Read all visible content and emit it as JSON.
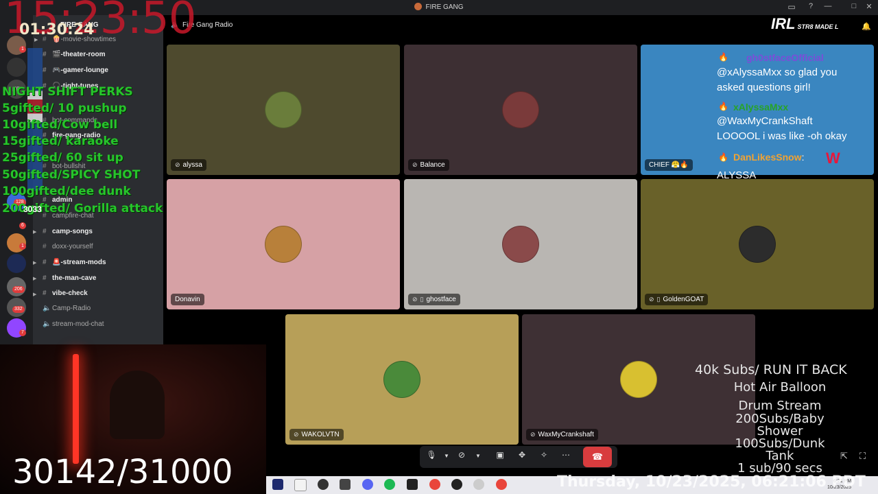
{
  "window": {
    "title": "FIRE GANG",
    "min": "—",
    "max": "□",
    "close": "✕"
  },
  "header": {
    "channel": "Fire Gang Radio",
    "brand": "IRL",
    "brand_sub": "STR8 MADE L"
  },
  "sidebar": {
    "server_label": "FIRE GANG",
    "channels": [
      {
        "name": "🍿-movie-showtimes",
        "bold": false
      },
      {
        "name": "🎬-theater-room",
        "bold": true
      },
      {
        "name": "🎮-gamer-lounge",
        "bold": true
      },
      {
        "name": "🎧-tight-tunes",
        "bold": true
      },
      {
        "name": "bot-commands",
        "bold": false
      },
      {
        "name": "fire-gang-radio",
        "bold": true
      },
      {
        "name": "bot-bullshit",
        "bold": false
      },
      {
        "name": "admin",
        "bold": true
      },
      {
        "name": "campfire-chat",
        "bold": false
      },
      {
        "name": "camp-songs",
        "bold": true
      },
      {
        "name": "doxx-yourself",
        "bold": false
      },
      {
        "name": "🚨-stream-mods",
        "bold": true
      },
      {
        "name": "the-man-cave",
        "bold": true
      },
      {
        "name": "vibe-check",
        "bold": true
      },
      {
        "name": "Camp-Radio",
        "bold": false
      },
      {
        "name": "stream-mod-chat",
        "bold": false
      }
    ],
    "badges": [
      "1",
      "128",
      "6",
      "1",
      "206",
      "332",
      "7"
    ]
  },
  "tiles": [
    {
      "name": "alyssa",
      "bg": "#4e4a2e"
    },
    {
      "name": "Balance",
      "bg": "#3d2f33"
    },
    {
      "name": "CHIEF 😤🔥",
      "bg": "#3a86c0"
    },
    {
      "name": "Donavin",
      "bg": "#d6a1a5"
    },
    {
      "name": "ghostface",
      "bg": "#b9b6b2"
    },
    {
      "name": "GoldenGOAT",
      "bg": "#696129"
    },
    {
      "name": "WAKOLVTN",
      "bg": "#b79f58"
    },
    {
      "name": "WaxMyCrankshaft",
      "bg": "#3e3034"
    }
  ],
  "chat": {
    "user1": "gh0stfaceOfficial",
    "msg1a": "@xAlyssaMxx so glad you",
    "msg1b": "asked questions girl!",
    "user2": "xAlyssaMxx",
    "msg2a": "@WaxMyCrankShaft",
    "msg2b": "LOOOOL i was like -oh okay",
    "user3": "DanLikesSnow",
    "user3_suffix": ":",
    "msg3": "ALYSSA",
    "user_colors": {
      "u1": "#7b4dd8",
      "u2": "#27a327",
      "u3": "#f2a332"
    }
  },
  "overlay": {
    "clock": "15:23:50",
    "timer": "01:30:24",
    "perks_title": "NIGHT SHIFT PERKS",
    "perks": [
      "5gifted/ 10 pushup",
      "10gifted/Cow bell",
      "15gifted/ karaoke",
      "25gifted/ 60 sit up",
      "50gifted/SPICY SHOT",
      "100gifted/dee dunk",
      "200gifted/ Gorilla attack"
    ],
    "small_count": "3033",
    "counter": "30142/31000",
    "goals": [
      "40k Subs/ RUN IT BACK",
      "Hot Air Balloon",
      "Drum Stream",
      "200Subs/Baby",
      "Shower",
      "100Subs/Dunk",
      "Tank",
      "1 sub/90 secs"
    ],
    "datetime": "Thursday, 10/23/2025, 06:21:06 PDT"
  },
  "taskbar": {
    "time": "6:21 PM",
    "date": "10/23/2025"
  }
}
